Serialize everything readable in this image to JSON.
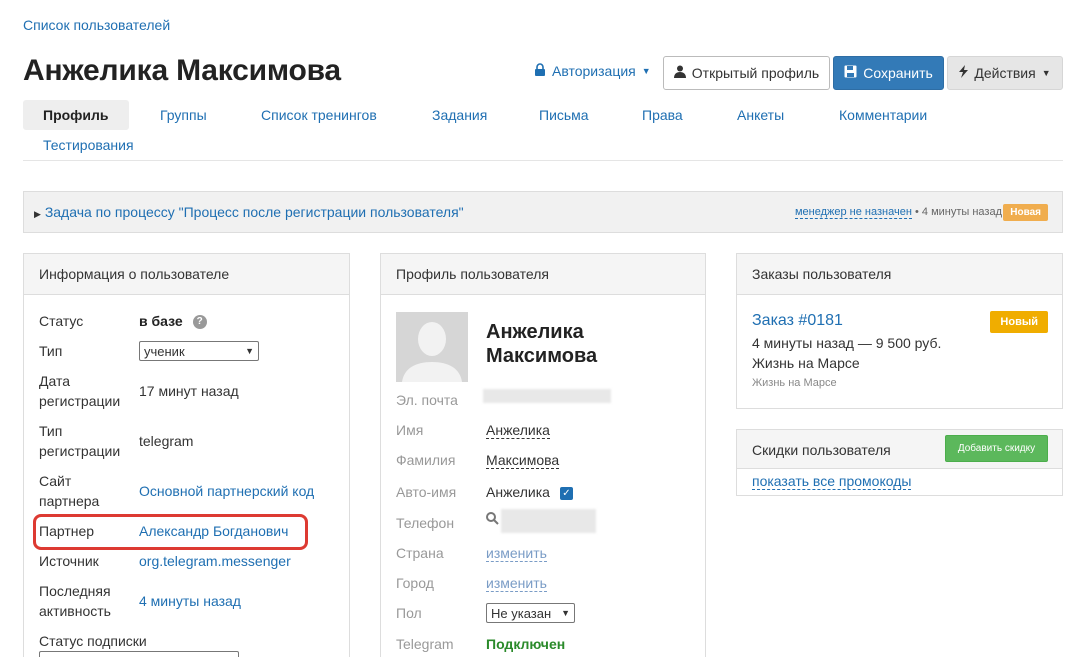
{
  "breadcrumb": "Список пользователей",
  "title": "Анжелика Максимова",
  "header": {
    "auth_label": "Авторизация",
    "open_profile_label": "Открытый профиль",
    "save_label": "Сохранить",
    "actions_label": "Действия"
  },
  "tabs": [
    "Профиль",
    "Группы",
    "Список тренингов",
    "Задания",
    "Письма",
    "Права",
    "Анкеты",
    "Комментарии",
    "Тестирования"
  ],
  "process": {
    "link": "Задача по процессу \"Процесс после регистрации пользователя\"",
    "manager": "менеджер не назначен",
    "time": "• 4 минуты назад",
    "badge": "Новая"
  },
  "info": {
    "title": "Информация о пользователе",
    "rows": {
      "status_label": "Статус",
      "status_value": "в базе",
      "type_label": "Тип",
      "type_value": "ученик",
      "reg_date_label1": "Дата",
      "reg_date_label2": "регистрации",
      "reg_date_value": "17 минут назад",
      "reg_type_label1": "Тип",
      "reg_type_label2": "регистрации",
      "reg_type_value": "telegram",
      "partner_site_label1": "Сайт",
      "partner_site_label2": "партнера",
      "partner_site_value": "Основной партнерский код",
      "partner_label": "Партнер",
      "partner_value": "Александр Богданович",
      "source_label": "Источник",
      "source_value": "org.telegram.messenger",
      "last_active_label1": "Последняя",
      "last_active_label2": "активность",
      "last_active_value": "4 минуты назад",
      "sub_status_label": "Статус подписки"
    }
  },
  "profile": {
    "title": "Профиль пользователя",
    "name_line1": "Анжелика",
    "name_line2": "Максимова",
    "email_label": "Эл. почта",
    "first_name_label": "Имя",
    "first_name_value": "Анжелика",
    "last_name_label": "Фамилия",
    "last_name_value": "Максимова",
    "auto_name_label": "Авто-имя",
    "auto_name_value": "Анжелика",
    "phone_label": "Телефон",
    "country_label": "Страна",
    "country_value": "изменить",
    "city_label": "Город",
    "city_value": "изменить",
    "gender_label": "Пол",
    "gender_value": "Не указан",
    "telegram_label": "Telegram",
    "telegram_value": "Подключен"
  },
  "orders": {
    "title": "Заказы пользователя",
    "order_link": "Заказ #0181",
    "badge": "Новый",
    "meta": "4 минуты назад — 9 500 руб.",
    "product": "Жизнь на Марсе",
    "product_small": "Жизнь на Марсе"
  },
  "discounts": {
    "title": "Скидки пользователя",
    "add_button": "Добавить скидку",
    "show_promos": "показать все промокоды"
  },
  "colors": {
    "link": "#1f6fb2",
    "primary": "#337ab7",
    "highlight": "#dd3a32",
    "badge": "#f0ad00",
    "green": "#5cb85c",
    "connected": "#2a8a2a"
  }
}
